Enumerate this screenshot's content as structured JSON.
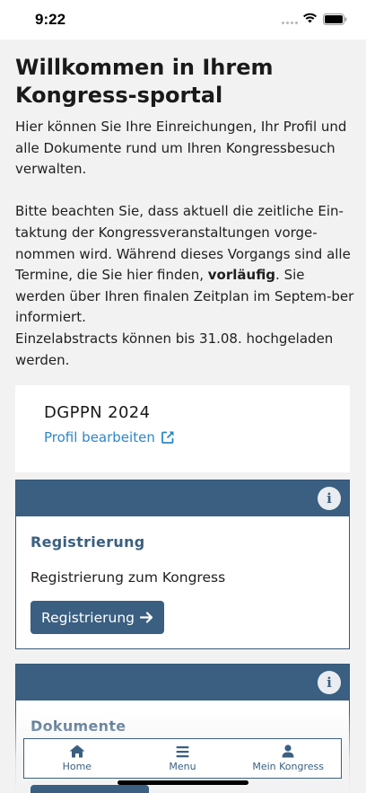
{
  "status_bar": {
    "time": "9:22"
  },
  "page": {
    "title": "Willkommen in Ihrem Kongress-sportal",
    "intro_1": "Hier können Sie Ihre Einreichungen, Ihr Profil und alle Dokumente rund um Ihren Kongressbesuch verwalten.",
    "intro_2_before": "Bitte beachten Sie, dass aktuell die zeitliche Ein-taktung der Kongressveranstaltungen vorge-nommen wird. Während dieses Vorgangs sind alle Termine, die Sie hier finden, ",
    "intro_2_bold": "vorläufig",
    "intro_2_after": ". Sie werden über Ihren finalen Zeitplan im Septem-ber informiert.",
    "intro_3": "Einzelabstracts können bis 31.08. hochgeladen werden."
  },
  "profile_card": {
    "title": "DGPPN 2024",
    "link_label": "Profil bearbeiten"
  },
  "registration_card": {
    "title": "Registrierung",
    "text": "Registrierung zum Kongress",
    "button_label": "Registrierung"
  },
  "documents_card": {
    "title": "Dokumente"
  },
  "tabbar": {
    "items": [
      {
        "label": "Home",
        "icon": "home-icon"
      },
      {
        "label": "Menu",
        "icon": "menu-icon"
      },
      {
        "label": "Mein Kongress",
        "icon": "user-icon"
      }
    ]
  },
  "colors": {
    "primary": "#3a5f80",
    "link": "#2f86c6",
    "background": "#f2f2f3"
  }
}
